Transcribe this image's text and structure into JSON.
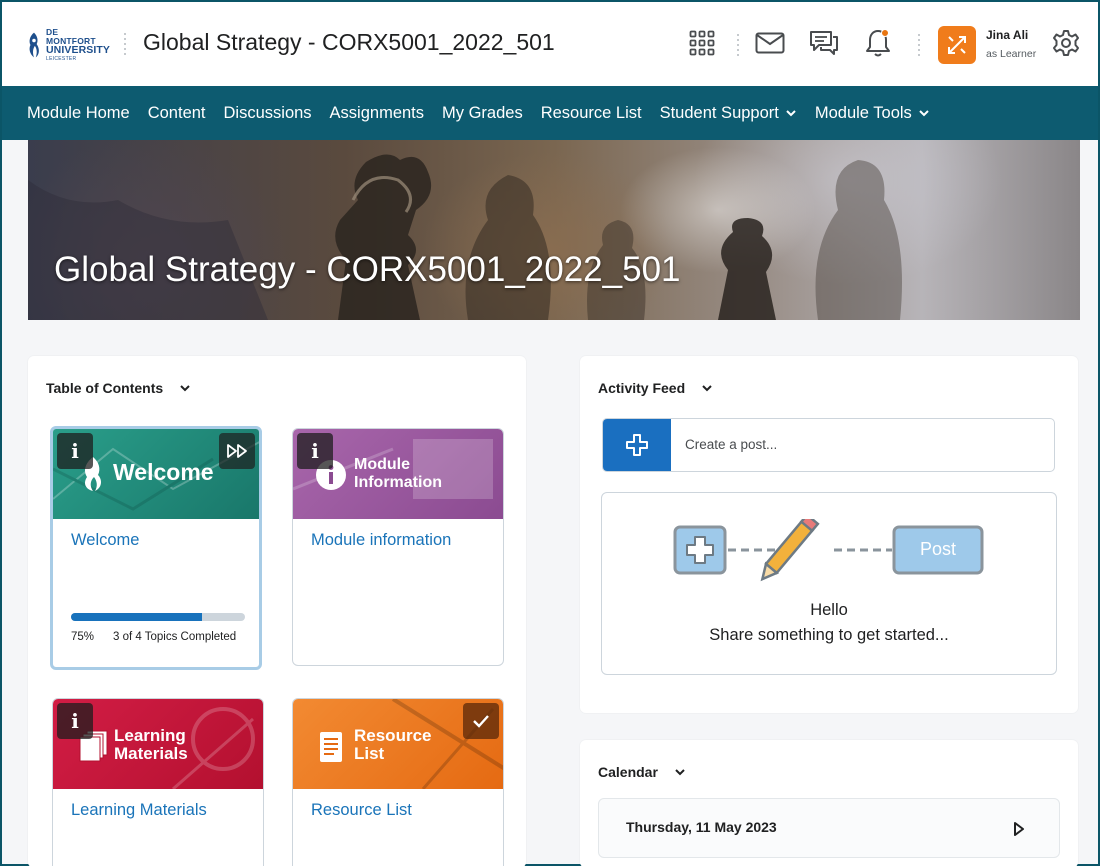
{
  "header": {
    "logo": {
      "line1": "DE MONTFORT",
      "line2": "UNIVERSITY",
      "line3": "LEICESTER"
    },
    "module_title": "Global Strategy - CORX5001_2022_501",
    "icons": [
      "app-grid-icon",
      "mail-icon",
      "chat-icon",
      "bell-icon",
      "gear-icon"
    ],
    "notification_dot_color": "#e87511",
    "user": {
      "name": "Jina Ali",
      "role": "as Learner",
      "avatar_color": "#f07c1b"
    }
  },
  "nav": {
    "items": [
      {
        "label": "Module Home"
      },
      {
        "label": "Content"
      },
      {
        "label": "Discussions"
      },
      {
        "label": "Assignments"
      },
      {
        "label": "My Grades"
      },
      {
        "label": "Resource List"
      },
      {
        "label": "Student Support"
      },
      {
        "label": "Module Tools"
      }
    ],
    "bg_color": "#0d5b70"
  },
  "banner": {
    "title": "Global Strategy - CORX5001_2022_501"
  },
  "toc": {
    "heading": "Table of Contents",
    "tiles": [
      {
        "image_label": "Welcome",
        "link": "Welcome",
        "color": "#1f8f7e",
        "progress": {
          "percent": 75,
          "percent_label": "75%",
          "text": "3 of 4 Topics Completed"
        }
      },
      {
        "image_label_1": "Module",
        "image_label_2": "Information",
        "link": "Module information",
        "color": "#9a5aa0"
      },
      {
        "image_label_1": "Learning",
        "image_label_2": "Materials",
        "link": "Learning Materials",
        "color": "#c8163d"
      },
      {
        "image_label_1": "Resource",
        "image_label_2": "List",
        "link": "Resource List",
        "color": "#ef7b22"
      }
    ]
  },
  "activity": {
    "heading": "Activity Feed",
    "placeholder": "Create a post...",
    "illustration_button": "Post",
    "hello": "Hello",
    "prompt": "Share something to get started..."
  },
  "calendar": {
    "heading": "Calendar",
    "date": "Thursday, 11 May 2023"
  }
}
